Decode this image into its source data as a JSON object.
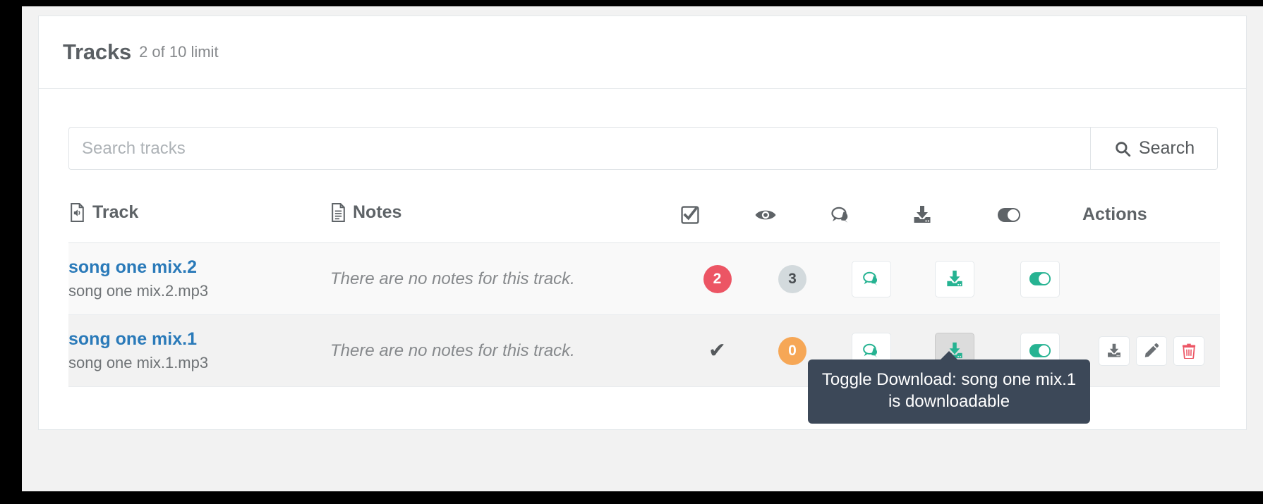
{
  "header": {
    "title": "Tracks",
    "subtitle": "2 of 10 limit"
  },
  "search": {
    "placeholder": "Search tracks",
    "button_label": "Search",
    "value": "",
    "icon": "search-icon"
  },
  "table": {
    "columns": {
      "track": "Track",
      "notes": "Notes",
      "approved_icon": "check-square-icon",
      "views_icon": "eye-icon",
      "comments_icon": "comments-icon",
      "download_icon": "download-icon",
      "toggle_icon": "toggle-on-icon",
      "actions": "Actions"
    },
    "rows": [
      {
        "name": "song one mix.2",
        "filename": "song one mix.2.mp3",
        "notes": "There are no notes for this track.",
        "approved": {
          "type": "badge",
          "value": "2",
          "color": "#ec5564"
        },
        "views": {
          "type": "badge",
          "value": "3",
          "color": "#d3dadd"
        },
        "comments_button": "comments-icon",
        "download_button": "download-icon",
        "toggle_button": "toggle-on-icon",
        "actions_visible": false
      },
      {
        "name": "song one mix.1",
        "filename": "song one mix.1.mp3",
        "notes": "There are no notes for this track.",
        "approved": {
          "type": "check",
          "value": "✔"
        },
        "views": {
          "type": "badge",
          "value": "0",
          "color": "#f6a756"
        },
        "comments_button": "comments-icon",
        "download_button": "download-icon",
        "toggle_button": "toggle-on-icon",
        "actions_visible": true,
        "actions": [
          {
            "icon": "download-icon",
            "color": "#6b7074"
          },
          {
            "icon": "pencil-icon",
            "color": "#6b7074"
          },
          {
            "icon": "trash-icon",
            "color": "#ec5564"
          }
        ]
      }
    ]
  },
  "tooltip": {
    "line1": "Toggle Download: song one mix.1",
    "line2": "is downloadable"
  },
  "colors": {
    "link": "#2a7ab9",
    "accent_teal": "#26b392",
    "danger": "#ec5564",
    "warning": "#f6a756",
    "tooltip_bg": "#3c4858"
  }
}
